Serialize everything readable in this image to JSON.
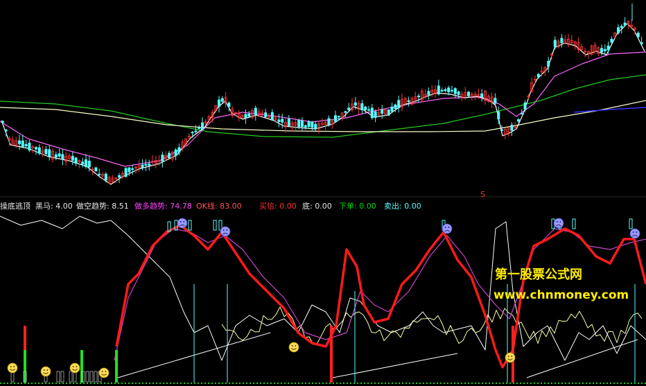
{
  "indicator_bar": {
    "name": "操底逃顶",
    "items": [
      {
        "label": "黑马: 4.00",
        "color": "#e8e8e8"
      },
      {
        "label": "做空趋势: 8.51",
        "color": "#e8e8e8"
      },
      {
        "label": "做多趋势: 74.78",
        "color": "#ff44ff"
      },
      {
        "label": "OK线: 83.00",
        "color": "#ff5555"
      },
      {
        "label": "买信: 0.00",
        "color": "#ff3333"
      },
      {
        "label": "底: 0.00",
        "color": "#e8e8e8"
      },
      {
        "label": "下单: 0.00",
        "color": "#00dd00"
      },
      {
        "label": "卖出: 0.00",
        "color": "#55ffff"
      }
    ]
  },
  "marker_s": "S",
  "watermark": {
    "line1": "第一股票公式网",
    "line2": "www.chnmoney.com"
  },
  "colors": {
    "up": "#ff3333",
    "down": "#55ffff",
    "ma_short": "#ffffff",
    "ma_mid": "#ff66ff",
    "ma_long": "#22cc22",
    "ma_slow": "#ffffcc",
    "blue": "#3333ff",
    "ok_line": "#ff1a1a",
    "trend_up": "#cc44cc",
    "trend_down": "#ffffaa"
  },
  "icons": {
    "buy": "smiley-face-icon",
    "sell": "frown-face-icon"
  }
}
